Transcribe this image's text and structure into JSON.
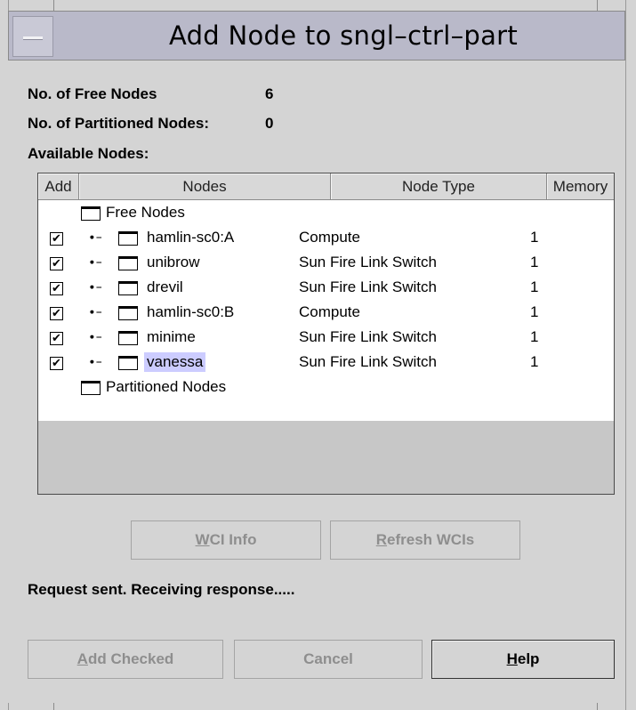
{
  "window": {
    "title": "Add Node to sngl–ctrl–part"
  },
  "stats": {
    "free_label": "No. of Free Nodes",
    "free_value": "6",
    "partitioned_label": "No. of Partitioned Nodes:",
    "partitioned_value": "0",
    "available_label": "Available Nodes:"
  },
  "table": {
    "headers": {
      "add": "Add",
      "nodes": "Nodes",
      "node_type": "Node Type",
      "memory": "Memory"
    },
    "groups": {
      "free": "Free Nodes",
      "partitioned": "Partitioned Nodes"
    },
    "rows": [
      {
        "checked": true,
        "checkmark": "✔",
        "name": "hamlin-sc0:A",
        "type": "Compute",
        "memory": "1",
        "selected": false
      },
      {
        "checked": true,
        "checkmark": "✔",
        "name": "unibrow",
        "type": "Sun Fire Link Switch",
        "memory": "1",
        "selected": false
      },
      {
        "checked": true,
        "checkmark": "✔",
        "name": "drevil",
        "type": "Sun Fire Link Switch",
        "memory": "1",
        "selected": false
      },
      {
        "checked": true,
        "checkmark": "✔",
        "name": "hamlin-sc0:B",
        "type": "Compute",
        "memory": "1",
        "selected": false
      },
      {
        "checked": true,
        "checkmark": "✔",
        "name": "minime",
        "type": "Sun Fire Link Switch",
        "memory": "1",
        "selected": false
      },
      {
        "checked": true,
        "checkmark": "✔",
        "name": "vanessa",
        "type": "Sun Fire Link Switch",
        "memory": "1",
        "selected": true
      }
    ],
    "expander_glyph": "∙–"
  },
  "buttons": {
    "wci_info": {
      "mnemonic": "W",
      "rest": "CI Info"
    },
    "refresh_wcis": {
      "mnemonic": "R",
      "rest": "efresh WCIs"
    },
    "add_checked": {
      "mnemonic": "A",
      "rest": "dd Checked"
    },
    "cancel": "Cancel",
    "help": {
      "mnemonic": "H",
      "rest": "elp"
    }
  },
  "status": "Request sent. Receiving response.....",
  "icons": {
    "menu": "window-menu-icon",
    "folder": "folder-icon",
    "key": "key-icon",
    "check": "checkmark-icon"
  },
  "colors": {
    "titlebar": "#b9b9c9",
    "selection": "#ccccff",
    "dialog": "#d4d4d4"
  }
}
